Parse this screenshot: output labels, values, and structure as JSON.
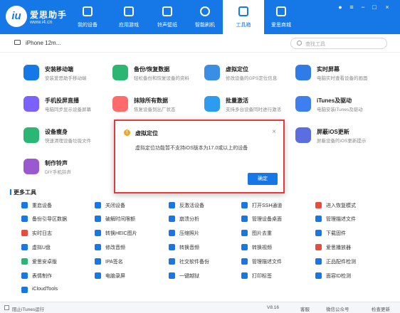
{
  "app": {
    "brand": "爱思助手",
    "domain": "www.i4.cn",
    "logo_text": "iu",
    "accent_color": "#1677e6"
  },
  "nav": {
    "items": [
      {
        "label": "我的设备",
        "icon": "phone-icon"
      },
      {
        "label": "应用游戏",
        "icon": "cube-icon"
      },
      {
        "label": "铃声壁纸",
        "icon": "music-file-icon"
      },
      {
        "label": "智能刷机",
        "icon": "refresh-icon"
      },
      {
        "label": "工具箱",
        "icon": "toolbox-icon"
      },
      {
        "label": "爱思商城",
        "icon": "store-icon"
      }
    ],
    "active_index": 4
  },
  "device": {
    "name": "iPhone 12m..."
  },
  "search": {
    "placeholder": "查找工具"
  },
  "features": [
    {
      "title": "安装移动端",
      "subtitle": "安装爱思助手移动端",
      "icon": "i4-app-icon",
      "color": "#1677e6"
    },
    {
      "title": "备份/恢复数据",
      "subtitle": "轻松备份和恢复设备的资料",
      "icon": "layers-icon",
      "color": "#2bb673"
    },
    {
      "title": "虚拟定位",
      "subtitle": "修改设备的GPS定位信息",
      "icon": "map-pin-icon",
      "color": "#3a8ee6"
    },
    {
      "title": "实时屏幕",
      "subtitle": "电脑实时查看设备的画面",
      "icon": "screen-icon",
      "color": "#2f7be8"
    },
    {
      "title": "手机投屏直播",
      "subtitle": "电脑同步显示设备屏幕",
      "icon": "cast-icon",
      "color": "#7b61ff"
    },
    {
      "title": "抹除所有数据",
      "subtitle": "恢复设备到出厂状态",
      "icon": "eraser-icon",
      "color": "#ff6b6b"
    },
    {
      "title": "批量激活",
      "subtitle": "支持多台设备同时进行激活",
      "icon": "batch-activate-icon",
      "color": "#2d9bf0"
    },
    {
      "title": "iTunes及驱动",
      "subtitle": "电脑安装iTunes及驱动",
      "icon": "music-note-icon",
      "color": "#3d7ef0"
    },
    {
      "title": "设备瘦身",
      "subtitle": "快速清理设备垃圾文件",
      "icon": "broom-icon",
      "color": "#2bb673"
    },
    {
      "title": "屏蔽iOS更新",
      "subtitle": "屏蔽设备的iOS更新提示",
      "icon": "block-update-icon",
      "color": "#5b6ee1"
    },
    {
      "title": "制作铃声",
      "subtitle": "DIY手机铃声",
      "icon": "ringtone-icon",
      "color": "#9b59d0"
    }
  ],
  "more_tools": {
    "title": "更多工具",
    "items": [
      {
        "label": "重启设备",
        "color": "#1677e6"
      },
      {
        "label": "关闭设备",
        "color": "#1677e6"
      },
      {
        "label": "反激活设备",
        "color": "#1677e6"
      },
      {
        "label": "打开SSH通道",
        "color": "#1677e6"
      },
      {
        "label": "进入恢复模式",
        "color": "#e74c3c"
      },
      {
        "label": "备份引导区数据",
        "color": "#1677e6"
      },
      {
        "label": "破解时间限额",
        "color": "#1677e6"
      },
      {
        "label": "崩溃分析",
        "color": "#1677e6"
      },
      {
        "label": "管理设备桌面",
        "color": "#1677e6"
      },
      {
        "label": "管理描述文件",
        "color": "#1677e6"
      },
      {
        "label": "实时日志",
        "color": "#e74c3c"
      },
      {
        "label": "转换HEIC图片",
        "color": "#1677e6"
      },
      {
        "label": "压缩照片",
        "color": "#1677e6"
      },
      {
        "label": "图片去重",
        "color": "#1677e6"
      },
      {
        "label": "下载固件",
        "color": "#1677e6"
      },
      {
        "label": "虚拟U盘",
        "color": "#1677e6"
      },
      {
        "label": "修改音频",
        "color": "#1677e6"
      },
      {
        "label": "转换音频",
        "color": "#1677e6"
      },
      {
        "label": "转换视频",
        "color": "#1677e6"
      },
      {
        "label": "爱思播放器",
        "color": "#e74c3c"
      },
      {
        "label": "爱思安卓版",
        "color": "#2bb673"
      },
      {
        "label": "IPA签名",
        "color": "#1677e6"
      },
      {
        "label": "社交软件备份",
        "color": "#1677e6"
      },
      {
        "label": "管理描述文件",
        "color": "#1677e6"
      },
      {
        "label": "正品配件检测",
        "color": "#1677e6"
      },
      {
        "label": "表情制作",
        "color": "#1677e6"
      },
      {
        "label": "电脑录屏",
        "color": "#1677e6"
      },
      {
        "label": "一键越狱",
        "color": "#1677e6"
      },
      {
        "label": "打印标签",
        "color": "#1677e6"
      },
      {
        "label": "面容ID检测",
        "color": "#1677e6"
      },
      {
        "label": "iCloudTools",
        "color": "#1677e6"
      }
    ]
  },
  "status": {
    "itunes_label": "阻止iTunes运行",
    "version": "V8.16",
    "links": [
      "客服",
      "微信公众号",
      "检查更新"
    ]
  },
  "dialog": {
    "title": "虚拟定位",
    "message": "虚拟定位功能暂不支持iOS版本为17.0或以上的设备",
    "confirm_label": "确定",
    "close_symbol": "×",
    "border_color": "#e23b3b"
  }
}
